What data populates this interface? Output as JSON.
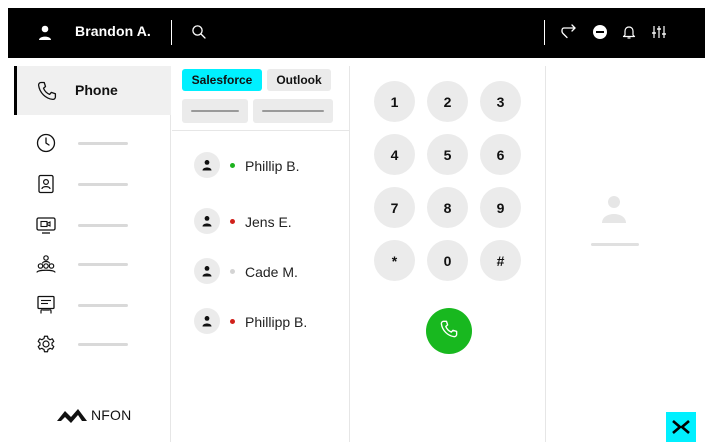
{
  "topbar": {
    "user_name": "Brandon A.",
    "icons": [
      "user-icon",
      "search-icon",
      "call-forward-icon",
      "do-not-disturb-icon",
      "bell-icon",
      "settings-sliders-icon"
    ]
  },
  "sidebar": {
    "active_label": "Phone",
    "items": [
      {
        "icon": "history-clock-icon"
      },
      {
        "icon": "contacts-card-icon"
      },
      {
        "icon": "meeting-screen-icon"
      },
      {
        "icon": "group-icon"
      },
      {
        "icon": "voicemail-icon"
      },
      {
        "icon": "settings-gear-icon"
      }
    ],
    "logo_text": "NFON"
  },
  "contacts": {
    "tabs": [
      "Salesforce",
      "Outlook"
    ],
    "list": [
      {
        "name": "Phillip B.",
        "status_color": "#1db21f"
      },
      {
        "name": "Jens E.",
        "status_color": "#d0201a"
      },
      {
        "name": "Cade M.",
        "status_color": "#d4d4d4"
      },
      {
        "name": "Phillipp B.",
        "status_color": "#d0201a"
      }
    ]
  },
  "dialpad": {
    "keys": [
      "1",
      "2",
      "3",
      "4",
      "5",
      "6",
      "7",
      "8",
      "9",
      "*",
      "0",
      "#"
    ]
  },
  "colors": {
    "accent": "#00f0ff",
    "call_green": "#18b81f",
    "topbar_bg": "#000000"
  }
}
